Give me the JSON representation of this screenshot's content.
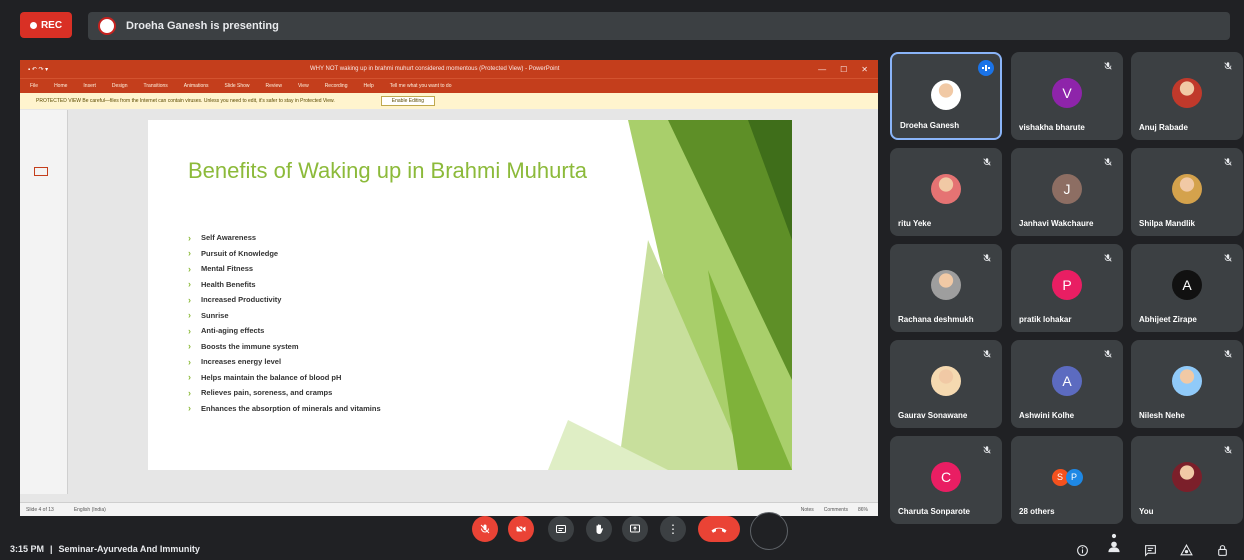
{
  "topbar": {
    "rec_label": "REC",
    "presenting_text": "Droeha Ganesh is presenting"
  },
  "powerpoint": {
    "title_text": "WHY NOT waking up in brahmi muhurt considered momentous (Protected View) - PowerPoint",
    "ribbon_tabs": [
      "File",
      "Home",
      "Insert",
      "Design",
      "Transitions",
      "Animations",
      "Slide Show",
      "Review",
      "View",
      "Recording",
      "Help",
      "Tell me what you want to do"
    ],
    "protected_text": "PROTECTED VIEW  Be careful—files from the Internet can contain viruses. Unless you need to edit, it's safer to stay in Protected View.",
    "enable_editing_label": "Enable Editing",
    "status_left": "Slide 4 of 13",
    "status_lang": "English (India)",
    "status_notes": "Notes",
    "status_comments": "Comments",
    "status_zoom": "86%"
  },
  "slide": {
    "title": "Benefits of Waking up in Brahmi Muhurta",
    "bullets": [
      "Self Awareness",
      "Pursuit of Knowledge",
      "Mental Fitness",
      "Health Benefits",
      "Increased Productivity",
      "Sunrise",
      "Anti-aging effects",
      "Boosts the immune system",
      "Increases energy level",
      "Helps maintain the balance of blood pH",
      "Relieves pain, soreness, and cramps",
      "Enhances the absorption of minerals and vitamins"
    ],
    "accent_color": "#8cba3a"
  },
  "participants": [
    {
      "name": "Droeha Ganesh",
      "avatar": "photo",
      "color": "#ffffff",
      "initial": "",
      "state": "speaking"
    },
    {
      "name": "vishakha bharute",
      "avatar": "letter",
      "color": "#8e24aa",
      "initial": "V",
      "state": "muted"
    },
    {
      "name": "Anuj Rabade",
      "avatar": "photo",
      "color": "#c0392b",
      "initial": "",
      "state": "muted"
    },
    {
      "name": "ritu Yeke",
      "avatar": "photo",
      "color": "#e57373",
      "initial": "",
      "state": "muted"
    },
    {
      "name": "Janhavi Wakchaure",
      "avatar": "letter",
      "color": "#8d6e63",
      "initial": "J",
      "state": "muted"
    },
    {
      "name": "Shilpa Mandlik",
      "avatar": "photo",
      "color": "#d4a24c",
      "initial": "",
      "state": "muted"
    },
    {
      "name": "Rachana deshmukh",
      "avatar": "photo",
      "color": "#9e9e9e",
      "initial": "",
      "state": "muted"
    },
    {
      "name": "pratik lohakar",
      "avatar": "letter",
      "color": "#e91e63",
      "initial": "P",
      "state": "muted"
    },
    {
      "name": "Abhijeet Zirape",
      "avatar": "logo",
      "color": "#111111",
      "initial": "A",
      "state": "muted"
    },
    {
      "name": "Gaurav Sonawane",
      "avatar": "photo",
      "color": "#f5d9b0",
      "initial": "",
      "state": "muted"
    },
    {
      "name": "Ashwini Kolhe",
      "avatar": "letter",
      "color": "#5c6bc0",
      "initial": "A",
      "state": "muted"
    },
    {
      "name": "Nilesh Nehe",
      "avatar": "photo",
      "color": "#90caf9",
      "initial": "",
      "state": "muted"
    },
    {
      "name": "Charuta Sonparote",
      "avatar": "letter",
      "color": "#e91e63",
      "initial": "C",
      "state": "muted"
    },
    {
      "name": "28 others",
      "avatar": "group",
      "color": "#f4511e",
      "initial": "S",
      "initial2": "P",
      "color2": "#1e88e5",
      "state": "none"
    },
    {
      "name": "You",
      "avatar": "photo",
      "color": "#7b1f2a",
      "initial": "",
      "state": "muted"
    }
  ],
  "bottombar": {
    "time": "3:15 PM",
    "separator": "|",
    "meeting_name": "Seminar-Ayurveda And Immunity"
  },
  "colors": {
    "bg": "#202124",
    "tile": "#3c4043",
    "red": "#ea4335",
    "ppt_red": "#c43e1c"
  },
  "icons": [
    "mic-off-icon",
    "camera-off-icon",
    "captions-icon",
    "raise-hand-icon",
    "present-icon",
    "more-options-icon",
    "end-call-icon",
    "info-icon",
    "people-icon",
    "chat-icon",
    "activities-icon",
    "lock-icon"
  ]
}
